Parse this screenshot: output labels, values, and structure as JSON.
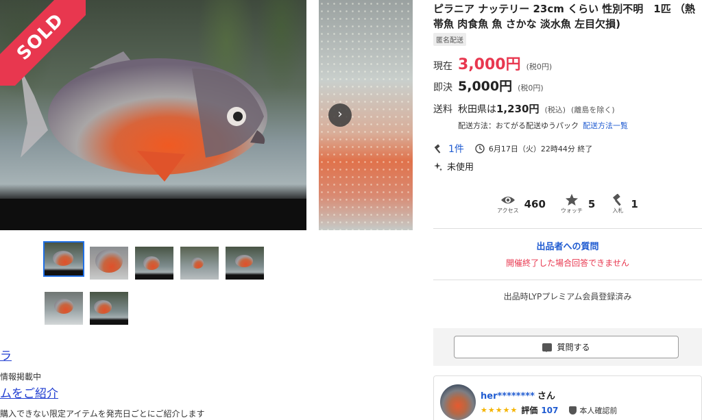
{
  "gallery": {
    "sold_badge": "SOLD",
    "next_arrow": "›",
    "thumbnail_count": 7,
    "active_thumbnail": 1
  },
  "left_links": {
    "link1": "ラ",
    "small1": "情報掲載中",
    "link2": "ムをご紹介",
    "small2": "購入できない限定アイテムを発売日ごとにご紹介します"
  },
  "item": {
    "title": "ピラニア ナッテリー 23cm くらい 性別不明　1匹 （熱帯魚 肉食魚 魚 さかな 淡水魚 左目欠損)",
    "tag": "匿名配送",
    "current_label": "現在",
    "current_price": "3,000円",
    "current_tax": "(税0円)",
    "buy_label": "即決",
    "buy_price": "5,000円",
    "buy_tax": "(税0円)",
    "ship_label": "送料",
    "ship_prefix": "秋田県は",
    "ship_price": "1,230円",
    "ship_tax": "(税込)",
    "ship_note": "(離島を除く)",
    "ship_method": "配送方法：おてがる配送ゆうパック",
    "ship_method_link": "配送方法一覧",
    "bid_count": "1件",
    "end_time": "6月17日（火）22時44分 終了",
    "condition": "未使用"
  },
  "stats": [
    {
      "label": "アクセス",
      "value": "460",
      "icon": "eye-icon"
    },
    {
      "label": "ウォッチ",
      "value": "5",
      "icon": "star-icon"
    },
    {
      "label": "入札",
      "value": "1",
      "icon": "gavel-icon"
    }
  ],
  "question": {
    "title": "出品者への質問",
    "closed_note": "開催終了した場合回答できません",
    "premium_note": "出品時LYPプレミアム会員登録済み",
    "button": "質問する"
  },
  "seller": {
    "name": "her********",
    "suffix": "さん",
    "stars": "★★★★★",
    "rating_label": "評価",
    "rating_value": "107",
    "verified": "本人確認前"
  },
  "colors": {
    "accent_red": "#e8374f",
    "link_blue": "#1f5bd1",
    "thumb_active": "#1f6fe5"
  }
}
